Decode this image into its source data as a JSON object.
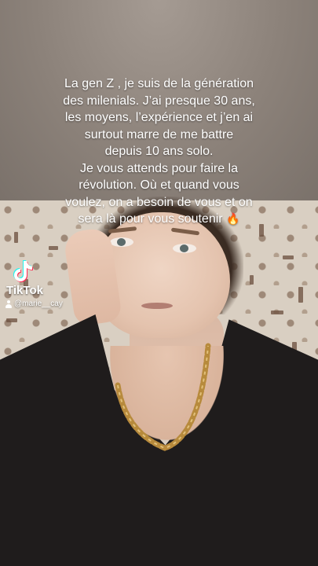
{
  "caption": {
    "text": "La gen Z , je suis de la génération\ndes milenials. J’ai presque 30 ans,\nles moyens, l’expérience et j’en ai\nsurtout marre de me battre\ndepuis 10 ans solo.\nJe vous attends pour faire la\nrévolution. Où et quand vous\nvoulez, on a besoin de vous et on\nsera là pour vous soutenir",
    "emoji": "🔥"
  },
  "watermark": {
    "brand": "TikTok",
    "username": "@marie__cay",
    "logo_icon": "tiktok-logo-icon",
    "user_icon": "person-icon"
  }
}
